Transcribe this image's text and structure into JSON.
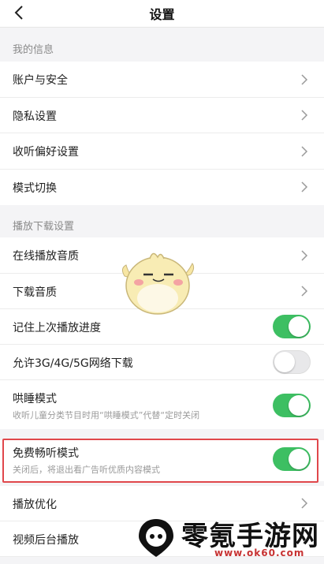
{
  "header": {
    "title": "设置"
  },
  "sections": {
    "my_info": "我的信息",
    "playback": "播放下载设置"
  },
  "rows": {
    "account": "账户与安全",
    "privacy": "隐私设置",
    "listen_pref": "收听偏好设置",
    "mode_switch": "模式切换",
    "online_quality": "在线播放音质",
    "download_quality": "下载音质",
    "remember_progress": "记住上次播放进度",
    "allow_cellular": "允许3G/4G/5G网络下载",
    "sleep_mode": "哄睡模式",
    "sleep_mode_sub": "收听儿童分类节目时用“哄睡模式”代替“定时关闭",
    "free_mode": "免费畅听模式",
    "free_mode_sub": "关闭后，将退出看广告听优质内容模式",
    "playback_opt": "播放优化",
    "video_background": "视频后台播放"
  },
  "toggles": {
    "remember_progress": true,
    "allow_cellular": false,
    "sleep_mode": true,
    "free_mode": true
  },
  "watermark": {
    "text": "零氪手游网",
    "url": "www.ok60.com"
  },
  "colors": {
    "accent": "#3dbf62",
    "highlight": "#e0474b"
  }
}
